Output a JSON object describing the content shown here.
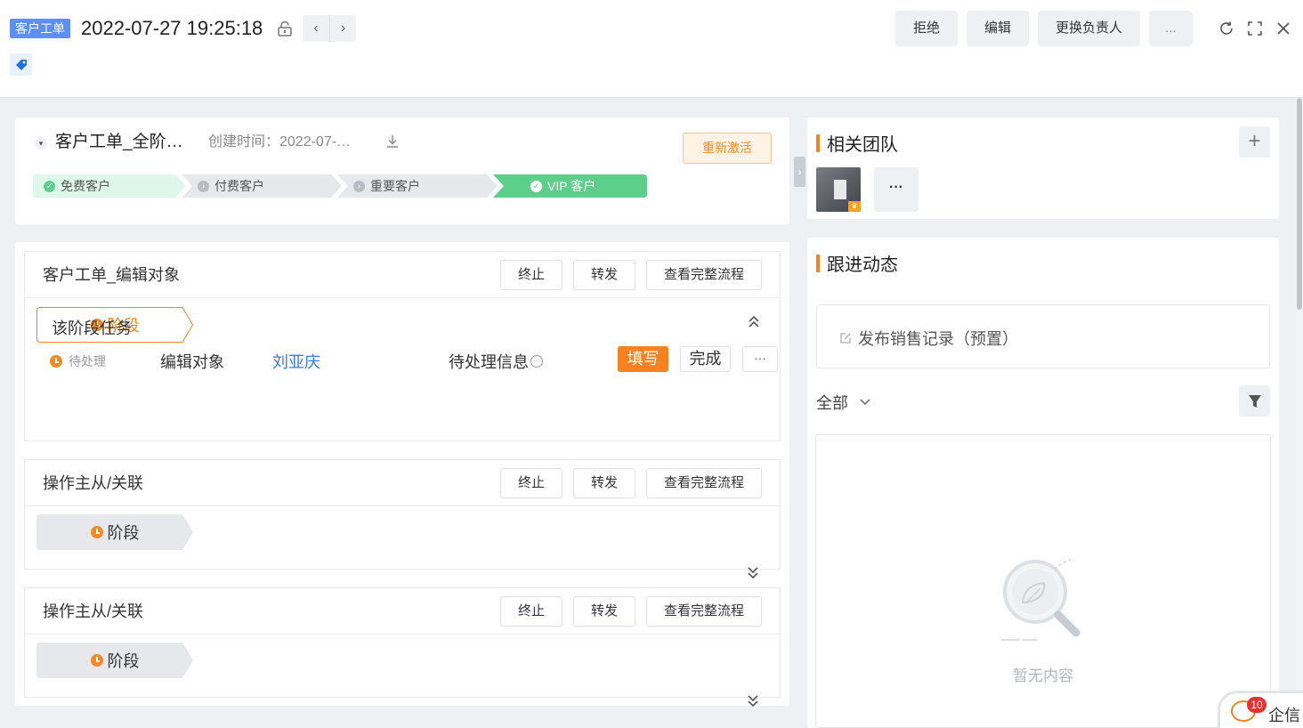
{
  "header": {
    "object_tag": "客户工单",
    "record_title": "2022-07-27 19:25:18",
    "nav_prev": "‹",
    "nav_next": "›",
    "actions": [
      "拒绝",
      "编辑",
      "更换负责人",
      "..."
    ],
    "icons": [
      "refresh-icon",
      "fullscreen-icon",
      "close-icon"
    ]
  },
  "summary": {
    "name": "客户工单_全阶…",
    "created": "创建时间：2022-07-…",
    "reactivate_label": "重新激活",
    "stages": [
      {
        "label": "免费客户",
        "state": "done"
      },
      {
        "label": "付费客户",
        "state": "pending"
      },
      {
        "label": "重要客户",
        "state": "pending"
      },
      {
        "label": "VIP 客户",
        "state": "current"
      }
    ]
  },
  "flows": [
    {
      "title": "客户工单_编辑对象",
      "buttons": [
        "终止",
        "转发",
        "查看完整流程"
      ],
      "stage_label": "阶段",
      "stage_active": true,
      "task_section_title": "该阶段任务",
      "task": {
        "status": "待处理",
        "name": "编辑对象",
        "owner": "刘亚庆",
        "info": "待处理信息",
        "fill_label": "填写",
        "done_label": "完成",
        "more_label": "···"
      }
    },
    {
      "title": "操作主从/关联",
      "buttons": [
        "终止",
        "转发",
        "查看完整流程"
      ],
      "stage_label": "阶段",
      "stage_active": false
    },
    {
      "title": "操作主从/关联",
      "buttons": [
        "终止",
        "转发",
        "查看完整流程"
      ],
      "stage_label": "阶段",
      "stage_active": false
    }
  ],
  "team": {
    "title": "相关团队",
    "add_label": "+",
    "more_label": "···"
  },
  "follow": {
    "title": "跟进动态",
    "publish_label": "发布销售记录（预置）",
    "filter_label": "全部",
    "empty_text": "暂无内容"
  },
  "chat": {
    "count": "10",
    "label": "企信"
  },
  "colors": {
    "accent_orange": "#f7811e",
    "stage_green": "#5ccf8a",
    "stage_done_bg": "#dff6ea",
    "link_blue": "#3478f6",
    "tag_blue": "#5b8ff9"
  }
}
